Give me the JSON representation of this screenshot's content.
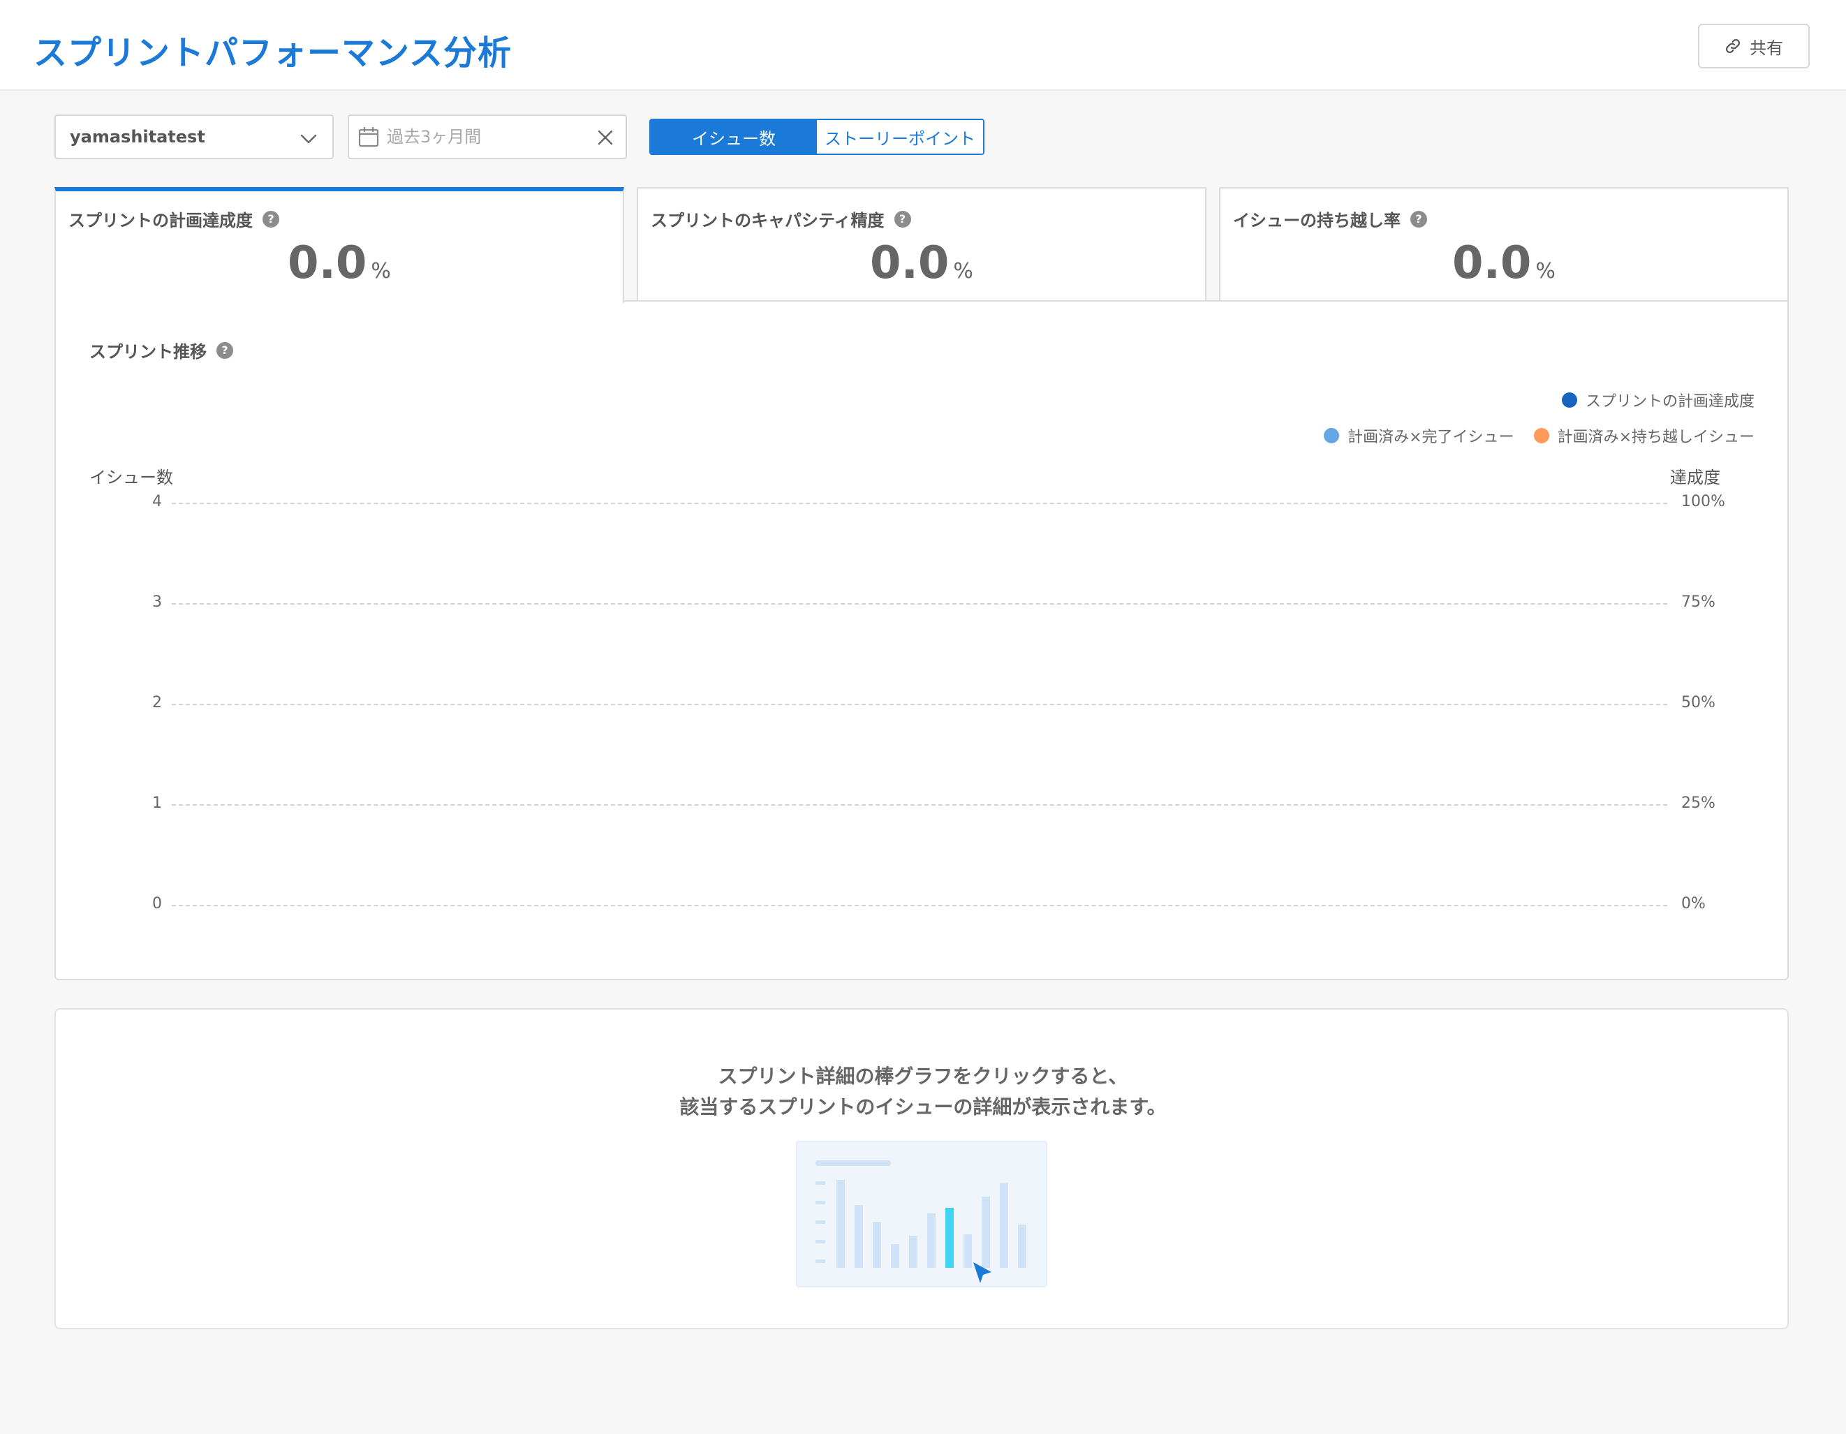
{
  "header": {
    "title": "スプリントパフォーマンス分析",
    "share_label": "共有"
  },
  "filters": {
    "project": "yamashitatest",
    "date_placeholder": "過去3ヶ月間",
    "toggle": {
      "options": [
        "イシュー数",
        "ストーリーポイント"
      ],
      "selected": "イシュー数"
    }
  },
  "metrics": [
    {
      "label": "スプリントの計画達成度",
      "value": "0.0",
      "unit": "%",
      "active": true
    },
    {
      "label": "スプリントのキャパシティ精度",
      "value": "0.0",
      "unit": "%",
      "active": false
    },
    {
      "label": "イシューの持ち越し率",
      "value": "0.0",
      "unit": "%",
      "active": false
    }
  ],
  "chart": {
    "title": "スプリント推移",
    "help": "?"
  },
  "chart_data": {
    "type": "bar",
    "title": "スプリント推移",
    "ylabel": "イシュー数",
    "y2label": "達成度",
    "ylim": [
      0,
      4
    ],
    "y2lim": [
      0,
      100
    ],
    "yticks": [
      "4",
      "3",
      "2",
      "1",
      "0"
    ],
    "y2ticks": [
      "100%",
      "75%",
      "50%",
      "25%",
      "0%"
    ],
    "categories": [],
    "series": [
      {
        "name": "スプリントの計画達成度",
        "type": "line",
        "color": "#1565c0",
        "values": []
      },
      {
        "name": "計画済み×完了イシュー",
        "type": "bar",
        "color": "#64a6e6",
        "values": []
      },
      {
        "name": "計画済み×持ち越しイシュー",
        "type": "bar",
        "color": "#ff9a5a",
        "values": []
      }
    ],
    "grid": true,
    "legend": "top-right"
  },
  "detail": {
    "line1": "スプリント詳細の棒グラフをクリックすると、",
    "line2": "該当するスプリントのイシューの詳細が表示されます。"
  },
  "colors": {
    "accent": "#1b7ad8",
    "illustration_highlight": "#3dd5f3",
    "illustration_bar": "#cfe2f6"
  }
}
